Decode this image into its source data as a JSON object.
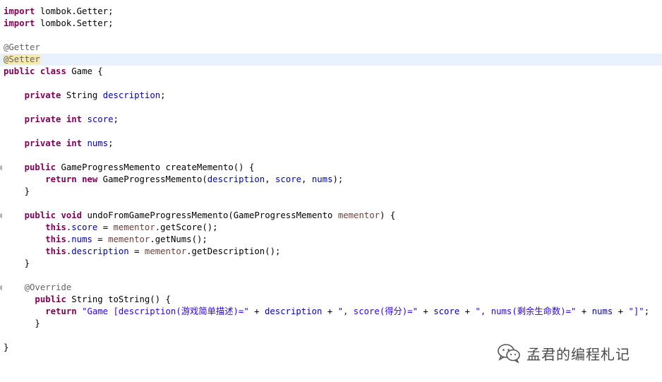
{
  "editor": {
    "lines": [
      {
        "tokens": [
          {
            "t": "import",
            "c": "kw"
          },
          {
            "t": " lombok.Getter;",
            "c": ""
          }
        ]
      },
      {
        "tokens": [
          {
            "t": "import",
            "c": "kw"
          },
          {
            "t": " lombok.Setter;",
            "c": ""
          }
        ]
      },
      {
        "tokens": []
      },
      {
        "tokens": [
          {
            "t": "@Getter",
            "c": "ann"
          }
        ]
      },
      {
        "tokens": [
          {
            "t": "@Setter",
            "c": "ann ann-occ"
          }
        ],
        "highlight": true
      },
      {
        "tokens": [
          {
            "t": "public",
            "c": "kw"
          },
          {
            "t": " ",
            "c": ""
          },
          {
            "t": "class",
            "c": "kw"
          },
          {
            "t": " Game {",
            "c": ""
          }
        ]
      },
      {
        "tokens": []
      },
      {
        "tokens": [
          {
            "t": "    ",
            "c": ""
          },
          {
            "t": "private",
            "c": "kw"
          },
          {
            "t": " String ",
            "c": ""
          },
          {
            "t": "description",
            "c": "field"
          },
          {
            "t": ";",
            "c": ""
          }
        ]
      },
      {
        "tokens": []
      },
      {
        "tokens": [
          {
            "t": "    ",
            "c": ""
          },
          {
            "t": "private",
            "c": "kw"
          },
          {
            "t": " ",
            "c": ""
          },
          {
            "t": "int",
            "c": "kw"
          },
          {
            "t": " ",
            "c": ""
          },
          {
            "t": "score",
            "c": "field"
          },
          {
            "t": ";",
            "c": ""
          }
        ]
      },
      {
        "tokens": []
      },
      {
        "tokens": [
          {
            "t": "    ",
            "c": ""
          },
          {
            "t": "private",
            "c": "kw"
          },
          {
            "t": " ",
            "c": ""
          },
          {
            "t": "int",
            "c": "kw"
          },
          {
            "t": " ",
            "c": ""
          },
          {
            "t": "nums",
            "c": "field"
          },
          {
            "t": ";",
            "c": ""
          }
        ]
      },
      {
        "tokens": []
      },
      {
        "tokens": [
          {
            "t": "    ",
            "c": ""
          },
          {
            "t": "public",
            "c": "kw"
          },
          {
            "t": " GameProgressMemento createMemento() {",
            "c": ""
          }
        ],
        "marker": true
      },
      {
        "tokens": [
          {
            "t": "        ",
            "c": ""
          },
          {
            "t": "return",
            "c": "kw"
          },
          {
            "t": " ",
            "c": ""
          },
          {
            "t": "new",
            "c": "kw"
          },
          {
            "t": " GameProgressMemento(",
            "c": ""
          },
          {
            "t": "description",
            "c": "field"
          },
          {
            "t": ", ",
            "c": ""
          },
          {
            "t": "score",
            "c": "field"
          },
          {
            "t": ", ",
            "c": ""
          },
          {
            "t": "nums",
            "c": "field"
          },
          {
            "t": ");",
            "c": ""
          }
        ]
      },
      {
        "tokens": [
          {
            "t": "    }",
            "c": ""
          }
        ]
      },
      {
        "tokens": []
      },
      {
        "tokens": [
          {
            "t": "    ",
            "c": ""
          },
          {
            "t": "public",
            "c": "kw"
          },
          {
            "t": " ",
            "c": ""
          },
          {
            "t": "void",
            "c": "kw"
          },
          {
            "t": " undoFromGameProgressMemento(GameProgressMemento ",
            "c": ""
          },
          {
            "t": "mementor",
            "c": "param"
          },
          {
            "t": ") {",
            "c": ""
          }
        ],
        "marker": true
      },
      {
        "tokens": [
          {
            "t": "        ",
            "c": ""
          },
          {
            "t": "this",
            "c": "kw"
          },
          {
            "t": ".",
            "c": ""
          },
          {
            "t": "score",
            "c": "field"
          },
          {
            "t": " = ",
            "c": ""
          },
          {
            "t": "mementor",
            "c": "param"
          },
          {
            "t": ".getScore();",
            "c": ""
          }
        ]
      },
      {
        "tokens": [
          {
            "t": "        ",
            "c": ""
          },
          {
            "t": "this",
            "c": "kw"
          },
          {
            "t": ".",
            "c": ""
          },
          {
            "t": "nums",
            "c": "field"
          },
          {
            "t": " = ",
            "c": ""
          },
          {
            "t": "mementor",
            "c": "param"
          },
          {
            "t": ".getNums();",
            "c": ""
          }
        ]
      },
      {
        "tokens": [
          {
            "t": "        ",
            "c": ""
          },
          {
            "t": "this",
            "c": "kw"
          },
          {
            "t": ".",
            "c": ""
          },
          {
            "t": "description",
            "c": "field"
          },
          {
            "t": " = ",
            "c": ""
          },
          {
            "t": "mementor",
            "c": "param"
          },
          {
            "t": ".getDescription();",
            "c": ""
          }
        ]
      },
      {
        "tokens": [
          {
            "t": "    }",
            "c": ""
          }
        ]
      },
      {
        "tokens": []
      },
      {
        "tokens": [
          {
            "t": "    ",
            "c": ""
          },
          {
            "t": "@Override",
            "c": "ann"
          }
        ],
        "marker": true
      },
      {
        "tokens": [
          {
            "t": "      ",
            "c": ""
          },
          {
            "t": "public",
            "c": "kw"
          },
          {
            "t": " String toString() {",
            "c": ""
          }
        ]
      },
      {
        "tokens": [
          {
            "t": "        ",
            "c": ""
          },
          {
            "t": "return",
            "c": "kw"
          },
          {
            "t": " ",
            "c": ""
          },
          {
            "t": "\"Game [description(游戏简单描述)=\"",
            "c": "str"
          },
          {
            "t": " + ",
            "c": ""
          },
          {
            "t": "description",
            "c": "field"
          },
          {
            "t": " + ",
            "c": ""
          },
          {
            "t": "\", score(得分)=\"",
            "c": "str"
          },
          {
            "t": " + ",
            "c": ""
          },
          {
            "t": "score",
            "c": "field"
          },
          {
            "t": " + ",
            "c": ""
          },
          {
            "t": "\", nums(剩余生命数)=\"",
            "c": "str"
          },
          {
            "t": " + ",
            "c": ""
          },
          {
            "t": "nums",
            "c": "field"
          },
          {
            "t": " + ",
            "c": ""
          },
          {
            "t": "\"]\"",
            "c": "str"
          },
          {
            "t": ";",
            "c": ""
          }
        ]
      },
      {
        "tokens": [
          {
            "t": "      }",
            "c": ""
          }
        ]
      },
      {
        "tokens": []
      },
      {
        "tokens": [
          {
            "t": "}",
            "c": ""
          }
        ]
      }
    ]
  },
  "watermark": {
    "text": "孟君的编程札记",
    "icon": "wechat-icon"
  }
}
